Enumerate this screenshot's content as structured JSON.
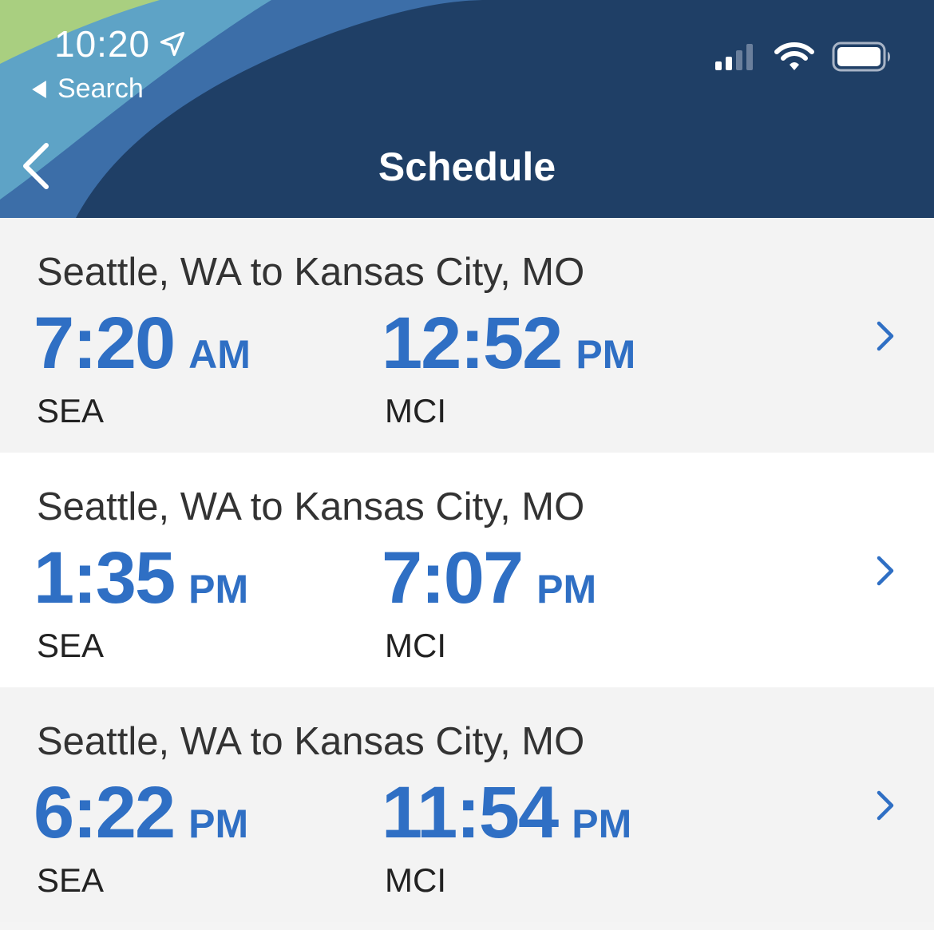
{
  "status_bar": {
    "time": "10:20",
    "back_label": "Search",
    "icons": [
      "location-arrow-icon",
      "cellular-signal-icon",
      "wifi-icon",
      "battery-icon"
    ]
  },
  "nav": {
    "title": "Schedule",
    "back_icon": "chevron-left-icon"
  },
  "colors": {
    "header_bg": "#1f3f66",
    "accent_blue": "#2f6fc4",
    "swoosh_green": "#a9cf80",
    "swoosh_light_blue": "#5ea3c6",
    "swoosh_mid_blue": "#3c6ea8"
  },
  "flights": [
    {
      "route": "Seattle, WA to Kansas City, MO",
      "depart_time": "7:20",
      "depart_ampm": "AM",
      "depart_code": "SEA",
      "arrive_time": "12:52",
      "arrive_ampm": "PM",
      "arrive_code": "MCI"
    },
    {
      "route": "Seattle, WA to Kansas City, MO",
      "depart_time": "1:35",
      "depart_ampm": "PM",
      "depart_code": "SEA",
      "arrive_time": "7:07",
      "arrive_ampm": "PM",
      "arrive_code": "MCI"
    },
    {
      "route": "Seattle, WA to Kansas City, MO",
      "depart_time": "6:22",
      "depart_ampm": "PM",
      "depart_code": "SEA",
      "arrive_time": "11:54",
      "arrive_ampm": "PM",
      "arrive_code": "MCI"
    }
  ]
}
